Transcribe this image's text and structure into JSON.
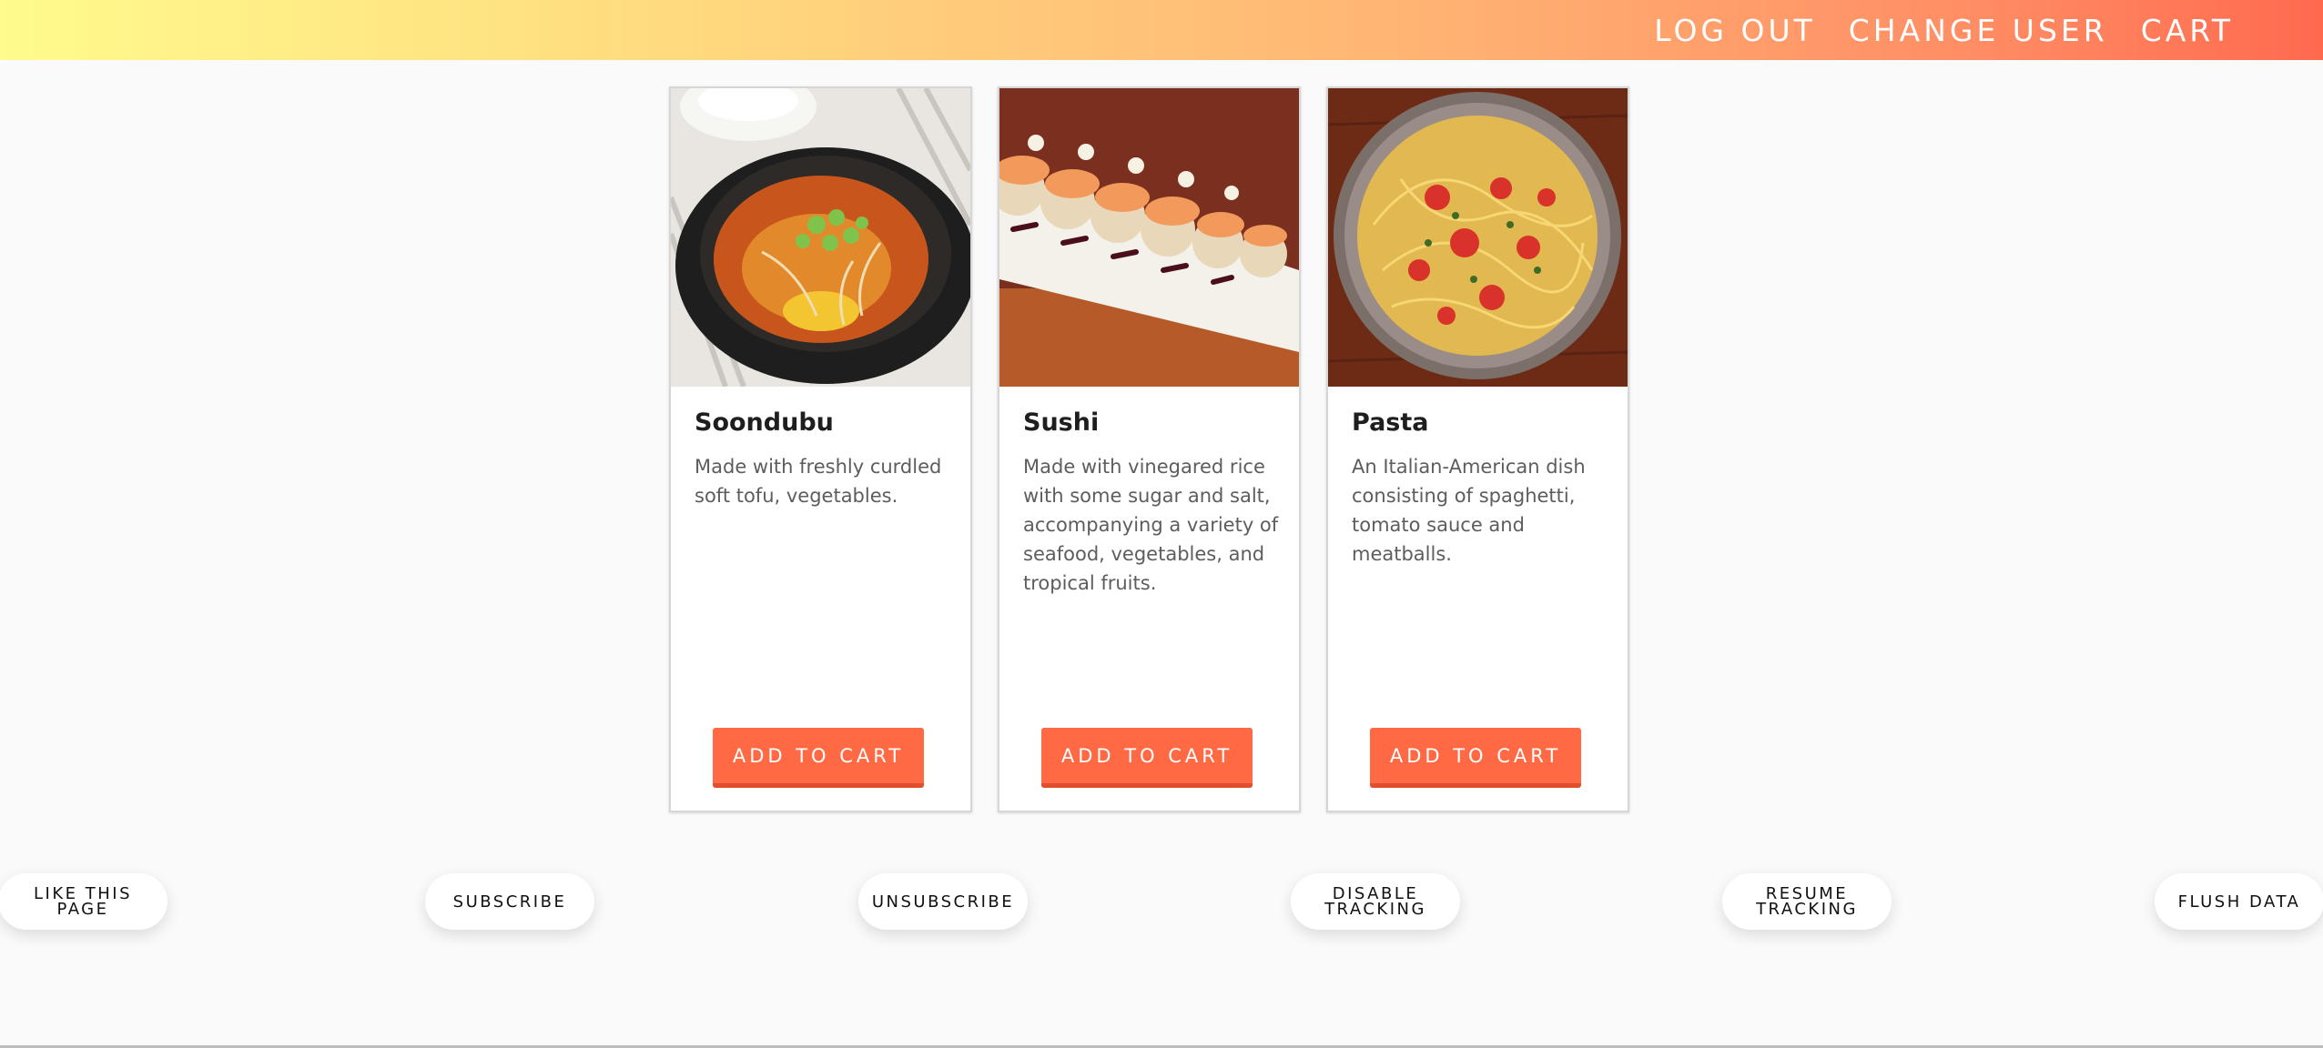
{
  "header": {
    "nav": [
      {
        "label": "LOG OUT"
      },
      {
        "label": "CHANGE USER"
      },
      {
        "label": "CART"
      }
    ]
  },
  "products": [
    {
      "title": "Soondubu",
      "description": "Made with freshly curdled soft tofu, vegetables.",
      "button": "ADD TO CART"
    },
    {
      "title": "Sushi",
      "description": "Made with vinegared rice with some sugar and salt, accompanying a variety of seafood, vegetables, and tropical fruits.",
      "button": "ADD TO CART"
    },
    {
      "title": "Pasta",
      "description": "An Italian-American dish consisting of spaghetti, tomato sauce and meatballs.",
      "button": "ADD TO CART"
    }
  ],
  "actions": [
    {
      "label": "LIKE THIS PAGE"
    },
    {
      "label": "SUBSCRIBE"
    },
    {
      "label": "UNSUBSCRIBE"
    },
    {
      "label": "DISABLE TRACKING"
    },
    {
      "label": "RESUME TRACKING"
    },
    {
      "label": "FLUSH DATA"
    }
  ],
  "colors": {
    "header_gradient_start": "#fffb8c",
    "header_gradient_end": "#ff6a4f",
    "accent_button": "#ff6a44",
    "page_background": "#fafafa"
  }
}
